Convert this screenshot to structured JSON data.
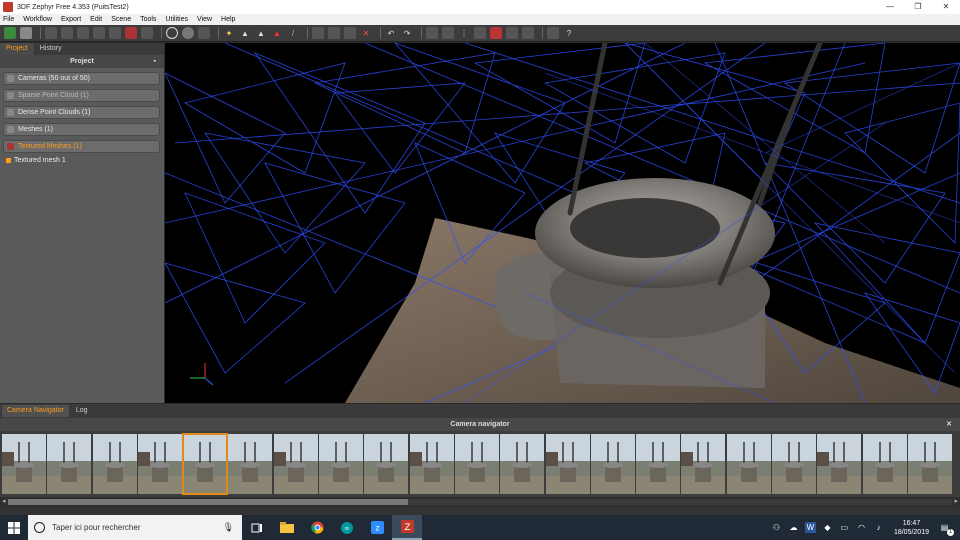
{
  "window": {
    "title": "3DF Zephyr Free 4.353 (PuitsTest2)",
    "controls": [
      "—",
      "❐",
      "✕"
    ]
  },
  "menu": [
    "File",
    "Workflow",
    "Export",
    "Edit",
    "Scene",
    "Tools",
    "Utilities",
    "View",
    "Help"
  ],
  "left_panel": {
    "tabs": [
      "Project",
      "History"
    ],
    "header": "Project",
    "items": [
      {
        "label": "Cameras (50 out of 50)"
      },
      {
        "label": "Sparse Point Cloud (1)"
      },
      {
        "label": "Dense Point Clouds (1)"
      },
      {
        "label": "Meshes (1)"
      },
      {
        "label": "Textured Meshes (1)"
      }
    ],
    "subitem": "Textured mesh 1"
  },
  "bottom": {
    "tabs": [
      "Camera Navigator",
      "Log"
    ],
    "header": "Camera navigator",
    "thumb_count": 21,
    "selected_index": 4
  },
  "taskbar": {
    "search_placeholder": "Taper ici pour rechercher",
    "time": "16:47",
    "date": "18/05/2019",
    "notification_count": "1"
  },
  "colors": {
    "accent": "#ff9c1a",
    "wireframe": "#2f4fff"
  }
}
